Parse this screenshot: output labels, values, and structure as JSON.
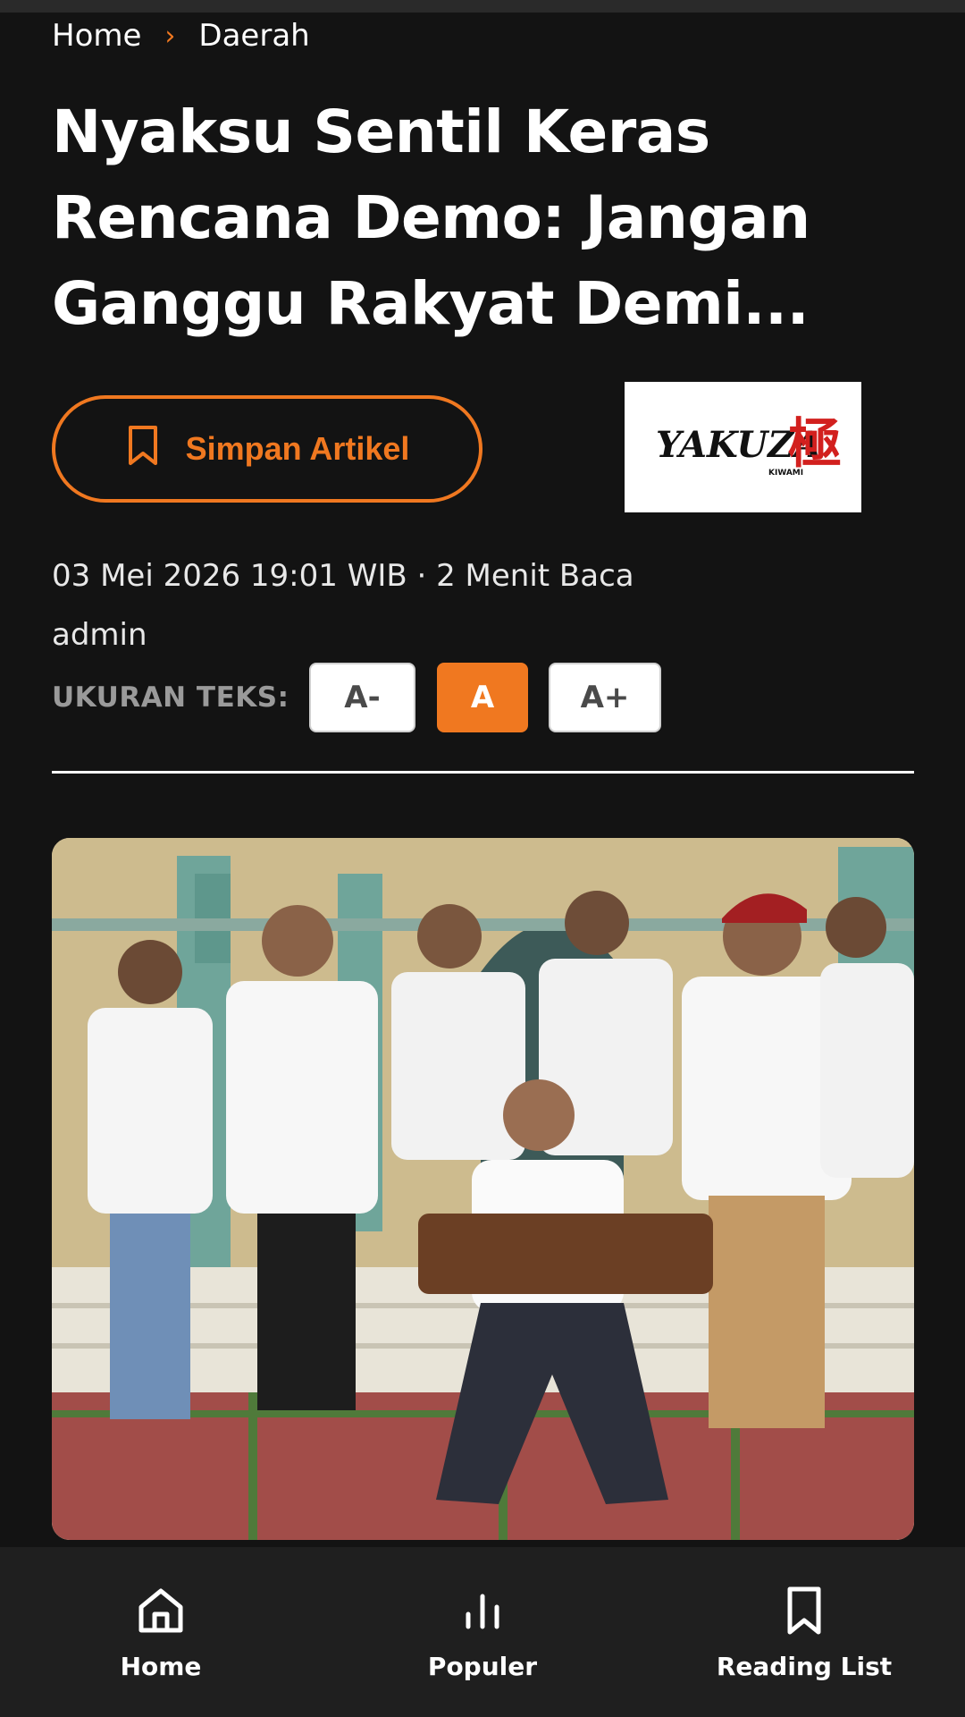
{
  "breadcrumb": {
    "home": "Home",
    "separator": "›",
    "category": "Daerah"
  },
  "article": {
    "title": "Nyaksu Sentil Keras Rencana Demo: Jangan Ganggu Rakyat Demi...",
    "save_label": "Simpan Artikel",
    "date_meta": "03 Mei 2026 19:01 WIB · 2 Menit Baca",
    "author": "admin",
    "photo_alt": "Group photo of seven men in white shirts in front of a house"
  },
  "ad": {
    "brand": "YAKUZA",
    "kanji": "極",
    "sub": "KIWAMI"
  },
  "text_size": {
    "label": "UKURAN TEKS:",
    "minus": "A-",
    "normal": "A",
    "plus": "A+"
  },
  "nav": {
    "home": "Home",
    "popular": "Populer",
    "reading_list": "Reading List"
  },
  "colors": {
    "accent": "#f07820",
    "background": "#131313",
    "nav_bg": "#1f1f1f"
  },
  "icons": [
    "bookmark-icon",
    "home-icon",
    "bar-chart-icon",
    "bookmark-icon"
  ]
}
